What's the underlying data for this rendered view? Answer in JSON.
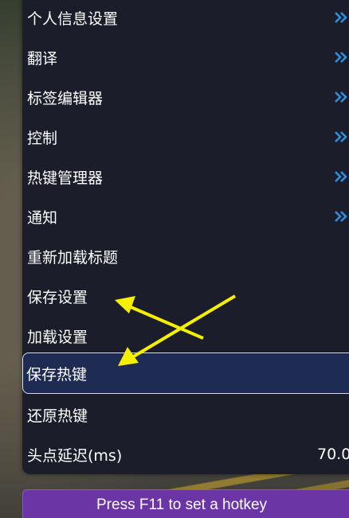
{
  "menu": {
    "items": [
      {
        "label": "个人信息设置",
        "has_submenu": true
      },
      {
        "label": "翻译",
        "has_submenu": true
      },
      {
        "label": "标签编辑器",
        "has_submenu": true
      },
      {
        "label": "控制",
        "has_submenu": true
      },
      {
        "label": "热键管理器",
        "has_submenu": true
      },
      {
        "label": "通知",
        "has_submenu": true
      },
      {
        "label": "重新加载标题",
        "has_submenu": false
      },
      {
        "label": "保存设置",
        "has_submenu": false
      },
      {
        "label": "加载设置",
        "has_submenu": false
      },
      {
        "label": "保存热键",
        "has_submenu": false,
        "selected": true
      },
      {
        "label": "还原热键",
        "has_submenu": false
      },
      {
        "label": "头点延迟(ms)",
        "has_submenu": false,
        "value": "70.0"
      }
    ]
  },
  "hotkey_hint": "Press F11 to set a hotkey",
  "colors": {
    "menu_background": "#1b1d2b",
    "selected_background": "#1e2b52",
    "chevron": "#2e8fe0",
    "hotkey_bar": "#6b35a6",
    "annotation_arrow": "#f5f000"
  }
}
